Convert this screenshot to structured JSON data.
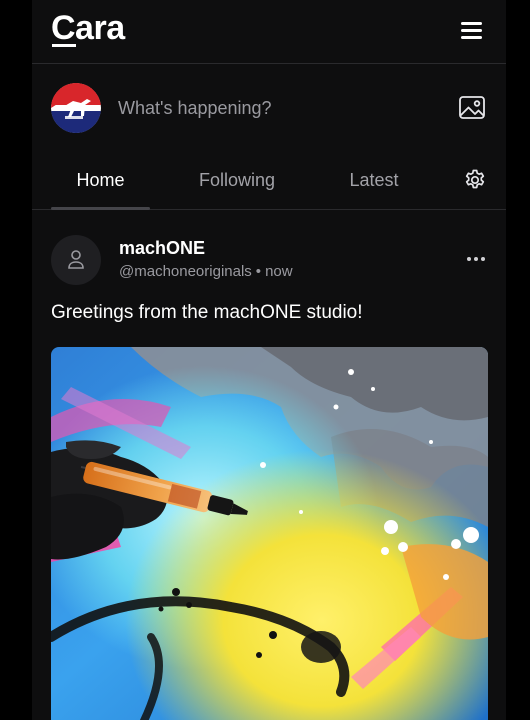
{
  "header": {
    "logo_text": "Cara",
    "menu_icon": "hamburger-menu-icon"
  },
  "composer": {
    "placeholder": "What's happening?",
    "image_icon": "image-icon"
  },
  "tabs": [
    {
      "label": "Home",
      "active": true
    },
    {
      "label": "Following",
      "active": false
    },
    {
      "label": "Latest",
      "active": false
    }
  ],
  "settings_icon": "gear-icon",
  "post": {
    "author_name": "machONE",
    "handle": "@machoneoriginals",
    "separator": "•",
    "time": "now",
    "text": "Greetings from the machONE studio!",
    "more_icon": "more-horizontal-icon"
  },
  "colors": {
    "background": "#0e0e0f",
    "divider": "#2a2a2d",
    "muted_text": "#9a9aa0"
  }
}
